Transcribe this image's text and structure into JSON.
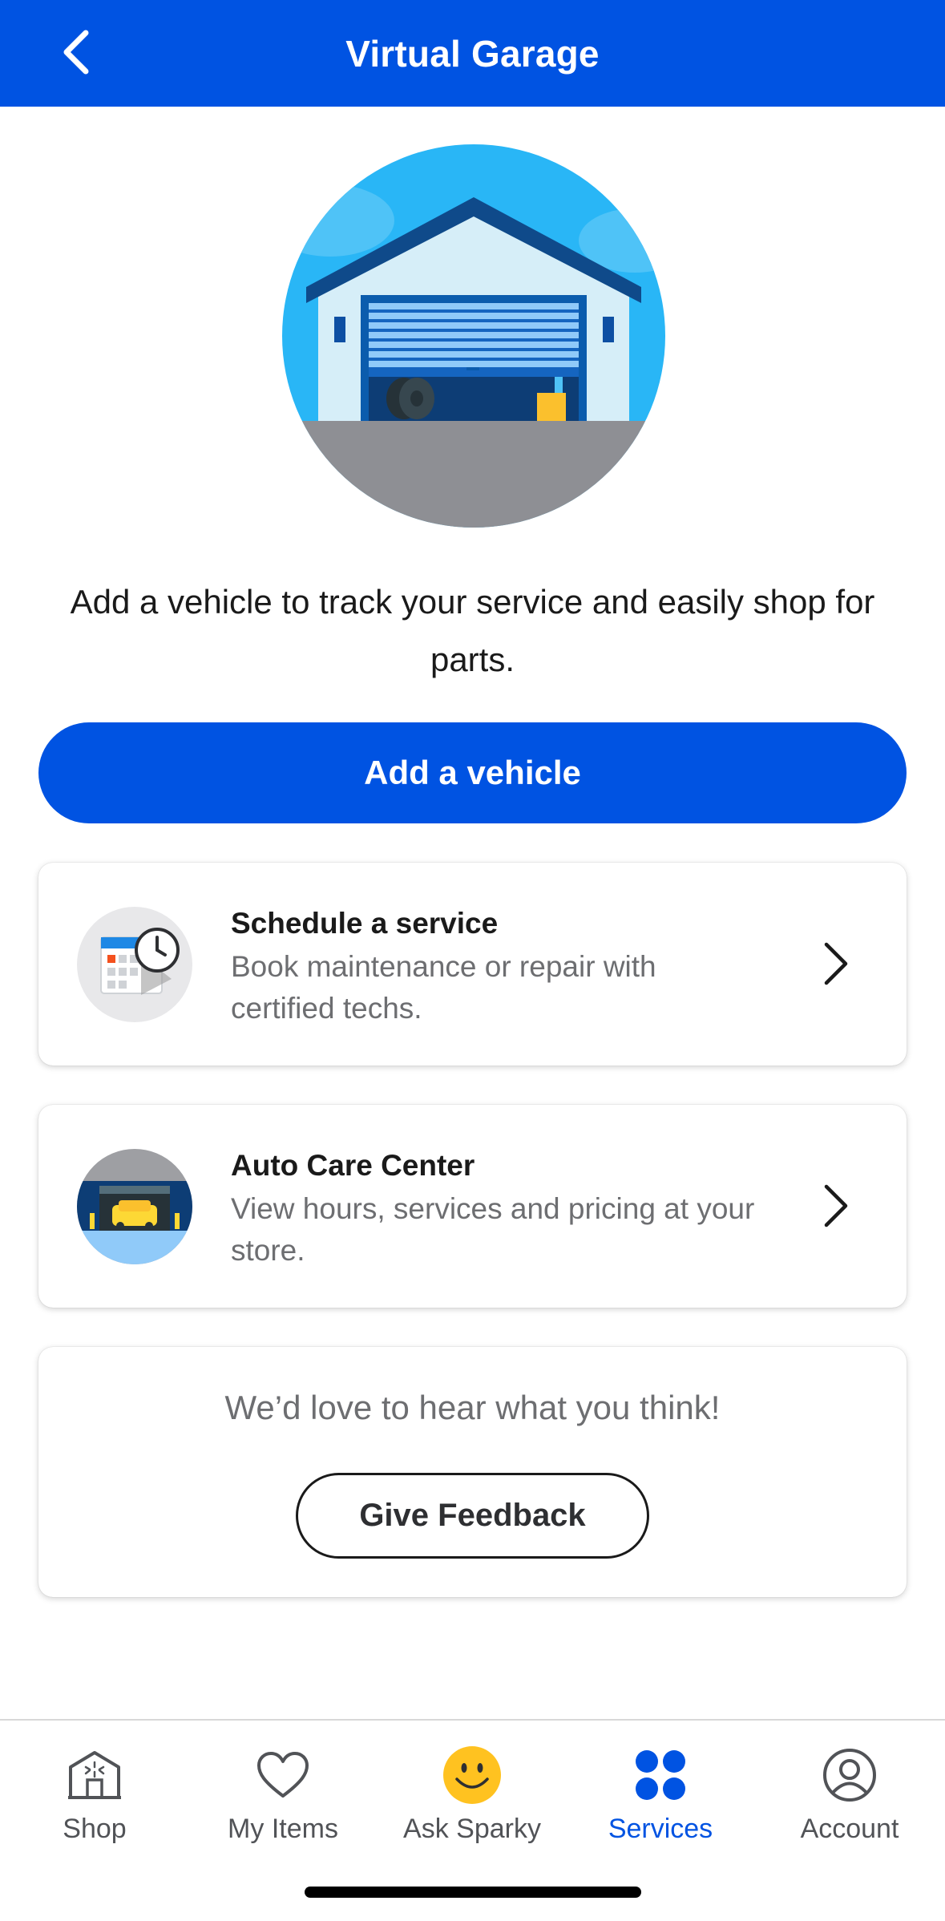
{
  "header": {
    "title": "Virtual Garage",
    "back_icon": "chevron-left-icon",
    "background": "#0053e2"
  },
  "hero": {
    "illustration": "garage-illustration"
  },
  "intro_text": "Add a vehicle to track your service and easily shop for parts.",
  "add_vehicle_label": "Add a vehicle",
  "cards": [
    {
      "title": "Schedule a service",
      "subtitle": "Book maintenance or repair with certified techs.",
      "icon": "calendar-clock-icon"
    },
    {
      "title": "Auto Care Center",
      "subtitle": "View hours, services and pricing at your store.",
      "icon": "auto-care-garage-icon"
    }
  ],
  "feedback": {
    "prompt": "We’d love to hear what you think!",
    "button_label": "Give Feedback"
  },
  "tabs": [
    {
      "label": "Shop",
      "icon": "store-icon",
      "active": false
    },
    {
      "label": "My Items",
      "icon": "heart-icon",
      "active": false
    },
    {
      "label": "Ask Sparky",
      "icon": "sparky-smiley-icon",
      "active": false
    },
    {
      "label": "Services",
      "icon": "services-dots-icon",
      "active": true
    },
    {
      "label": "Account",
      "icon": "account-icon",
      "active": false
    }
  ],
  "colors": {
    "brand_blue": "#0053e2",
    "sparky_yellow": "#ffc220"
  }
}
